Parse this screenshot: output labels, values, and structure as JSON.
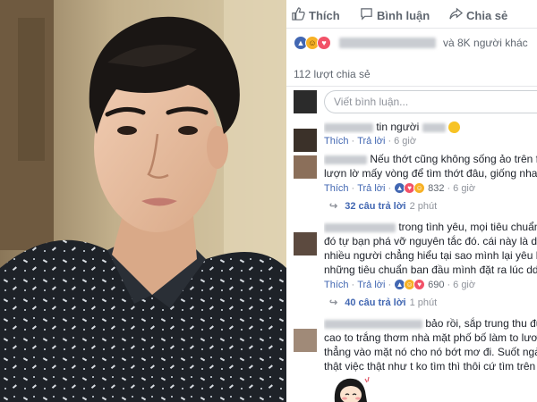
{
  "actions": {
    "like_label": "Thích",
    "comment_label": "Bình luận",
    "share_label": "Chia sẻ"
  },
  "reactions": {
    "others_text": "và 8K người khác"
  },
  "shares_text": "112 lượt chia sẻ",
  "comment_input": {
    "placeholder": "Viết bình luận..."
  },
  "comments": [
    {
      "lines": [
        "tin người"
      ],
      "like_label": "Thích",
      "reply_label": "Trả lời",
      "time": "6 giờ"
    },
    {
      "lines": [
        "Nếu thớt cũng không sống ảo trên fb thì",
        "lượn lờ mấy vòng để tìm thớt đâu, giống nhau cả t"
      ],
      "like_label": "Thích",
      "reply_label": "Trả lời",
      "reaction_count": "832",
      "time": "6 giờ",
      "replies_label": "32 câu trả lời",
      "replies_time": "2 phút"
    },
    {
      "lines": [
        "trong tình yêu, mọi tiêu chuẩn bạn",
        "đó tự bạn phá vỡ nguyên tắc đó. cái này là duyên",
        "nhiều người chẳng hiểu tại sao mình lại yêu hay lấ",
        "những tiêu chuẩn ban đầu mình đặt ra lúc ddầu tẹ"
      ],
      "like_label": "Thích",
      "reply_label": "Trả lời",
      "reaction_count": "690",
      "time": "6 giờ",
      "replies_label": "40 câu trả lời",
      "replies_time": "1 phút"
    },
    {
      "lines": [
        "bảo rồi, sắp trung thu đú",
        "cao to trắng thơm nhà mặt phố bố làm to lương rủ",
        "thẳng vào mặt nó cho nó bớt mơ đi. Suốt ngày ngo",
        "thật việc thật như t ko tìm thì thôi cứ tìm trên mạng"
      ]
    }
  ],
  "colors": {
    "fb_blue": "#4267b2",
    "text": "#1d2129",
    "muted": "#606770"
  }
}
